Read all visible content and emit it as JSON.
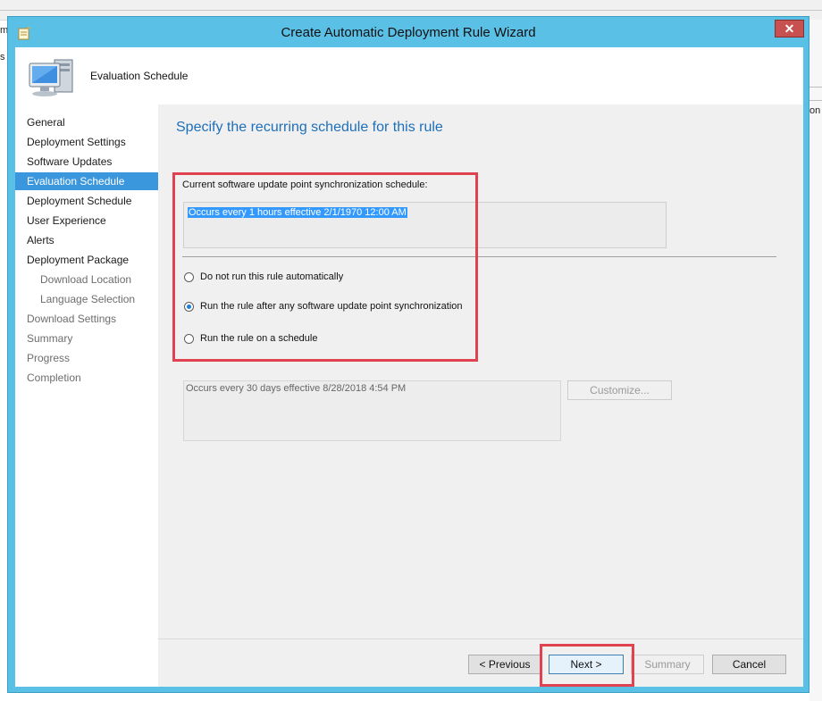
{
  "background": {
    "left_fragment_1": "m",
    "left_fragment_2": "s",
    "right_fragment": "on"
  },
  "window": {
    "title": "Create Automatic Deployment Rule Wizard",
    "close_glyph": "✕",
    "app_icon": "wizard-icon"
  },
  "header": {
    "title": "Evaluation Schedule",
    "icon": "computer-icon"
  },
  "nav": {
    "items": [
      {
        "label": "General",
        "state": "normal"
      },
      {
        "label": "Deployment Settings",
        "state": "normal"
      },
      {
        "label": "Software Updates",
        "state": "normal"
      },
      {
        "label": "Evaluation Schedule",
        "state": "active"
      },
      {
        "label": "Deployment Schedule",
        "state": "normal"
      },
      {
        "label": "User Experience",
        "state": "normal"
      },
      {
        "label": "Alerts",
        "state": "normal"
      },
      {
        "label": "Deployment Package",
        "state": "normal"
      },
      {
        "label": "Download Location",
        "state": "dim-sub"
      },
      {
        "label": "Language Selection",
        "state": "dim-sub"
      },
      {
        "label": "Download Settings",
        "state": "dim"
      },
      {
        "label": "Summary",
        "state": "dim"
      },
      {
        "label": "Progress",
        "state": "dim"
      },
      {
        "label": "Completion",
        "state": "dim"
      }
    ]
  },
  "content": {
    "heading": "Specify the recurring schedule for this rule",
    "sync_label": "Current software update point synchronization schedule:",
    "sync_schedule": "Occurs every 1 hours effective 2/1/1970 12:00 AM",
    "options": [
      {
        "label": "Do not run this rule automatically",
        "selected": false
      },
      {
        "label": "Run the rule after any software update point synchronization",
        "selected": true
      },
      {
        "label": "Run the rule on a schedule",
        "selected": false
      }
    ],
    "custom_schedule": "Occurs every 30 days effective 8/28/2018 4:54 PM",
    "customize_label": "Customize..."
  },
  "footer": {
    "previous_label": "< Previous",
    "next_label": "Next >",
    "summary_label": "Summary",
    "cancel_label": "Cancel"
  },
  "colors": {
    "title_bar": "#5bc0e6",
    "highlight_border": "#e0424f",
    "active_nav": "#3a96dd",
    "heading_text": "#1e6fba"
  }
}
